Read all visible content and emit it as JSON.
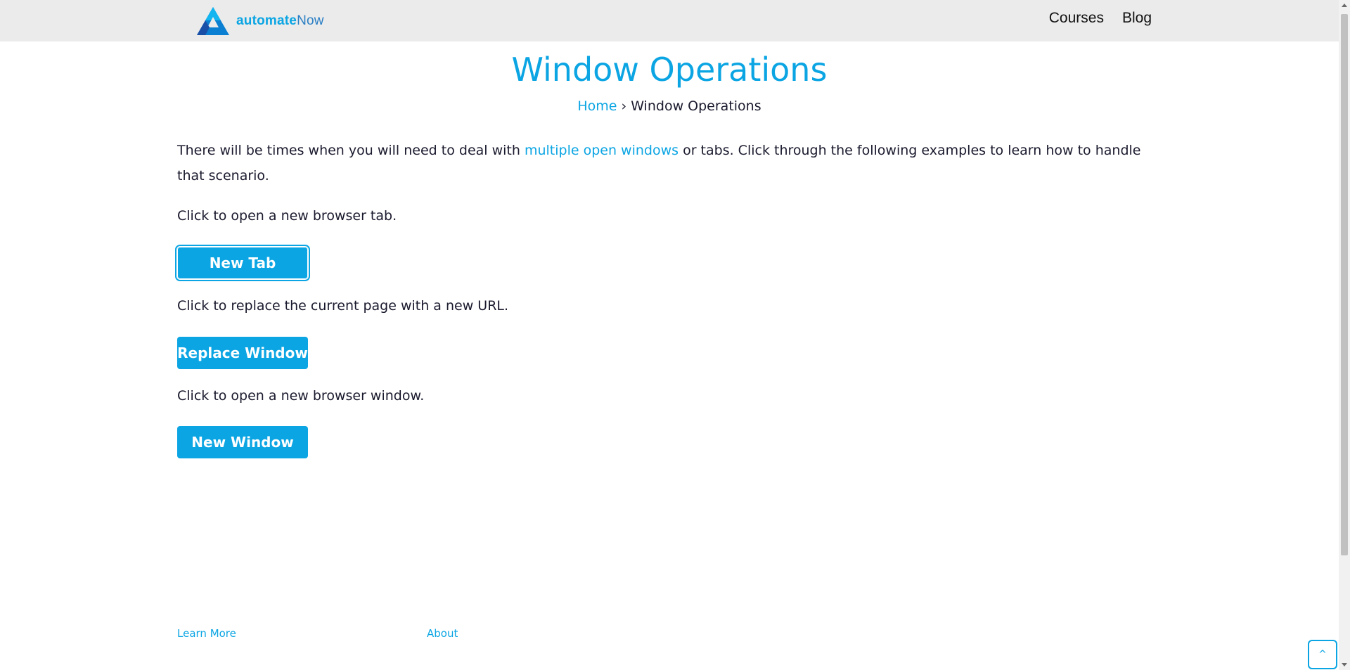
{
  "header": {
    "logo_text_bold": "automate",
    "logo_text_light": "Now",
    "nav": [
      "Courses",
      "Blog"
    ]
  },
  "page": {
    "title": "Window Operations",
    "breadcrumb_home": "Home",
    "breadcrumb_separator": "›",
    "breadcrumb_current": "Window Operations"
  },
  "intro": {
    "before_link": "There will be times when you will need to deal with ",
    "link_text": "multiple open windows",
    "after_link": " or tabs. Click through the following examples to learn how to handle that scenario."
  },
  "sections": [
    {
      "description": "Click to open a new browser tab.",
      "button": "New Tab"
    },
    {
      "description": "Click to replace the current page with a new URL.",
      "button": "Replace Window"
    },
    {
      "description": "Click to open a new browser window.",
      "button": "New Window"
    }
  ],
  "footer": {
    "links": [
      "Learn More",
      "About"
    ]
  },
  "back_to_top": {
    "icon": "chevron-up-icon",
    "glyph": "^"
  },
  "colors": {
    "accent": "#0ba5e3",
    "header_bg": "#ebebeb",
    "text": "#1a1a2e"
  }
}
